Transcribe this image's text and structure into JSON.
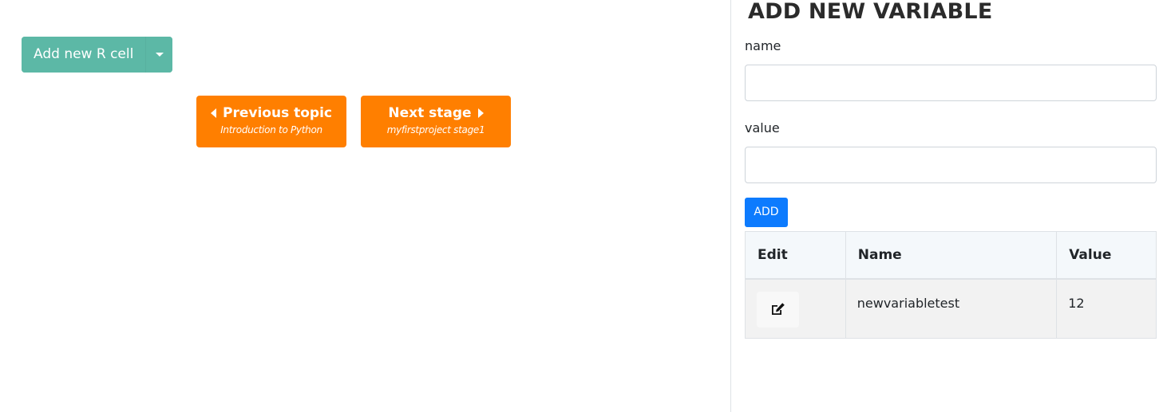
{
  "toolbar": {
    "add_cell_label": "Add new R cell"
  },
  "navigation": {
    "previous": {
      "title": "Previous topic",
      "subtitle": "Introduction to Python"
    },
    "next": {
      "title": "Next stage",
      "subtitle": "myfirstproject stage1"
    }
  },
  "variables_panel": {
    "title": "ADD NEW VARIABLE",
    "name_label": "name",
    "name_value": "",
    "value_label": "value",
    "value_value": "",
    "add_button_label": "ADD",
    "table": {
      "headers": [
        "Edit",
        "Name",
        "Value"
      ],
      "rows": [
        {
          "name": "newvariabletest",
          "value": "12"
        }
      ]
    }
  },
  "colors": {
    "add_cell_button": "#5cb8a6",
    "nav_button": "#ff7f00",
    "add_button": "#0d7bfe"
  },
  "icons": {
    "edit": "edit-icon",
    "dropdown": "caret-down-icon",
    "previous": "caret-left-icon",
    "next": "caret-right-icon"
  }
}
